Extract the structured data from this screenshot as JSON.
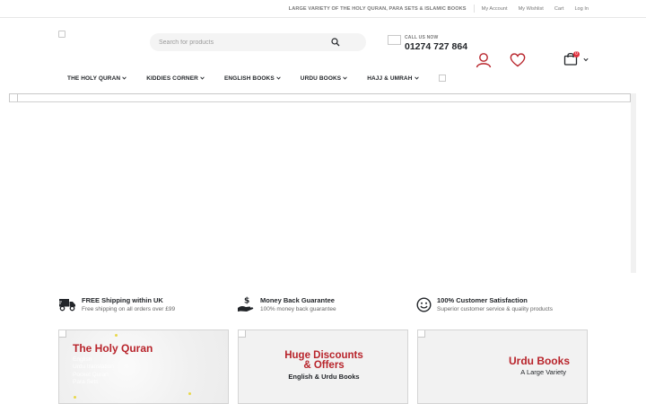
{
  "topbar": {
    "promo": "LARGE VARIETY OF THE HOLY QURAN, PARA SETS & ISLAMIC BOOKS",
    "links": [
      "My Account",
      "My Wishlist",
      "Cart",
      "Log In"
    ]
  },
  "header": {
    "search_placeholder": "Search for products",
    "call_label": "CALL US NOW",
    "phone": "01274 727 864",
    "cart_count": "0",
    "icons": [
      "search-icon",
      "user-icon",
      "heart-icon",
      "cart-icon"
    ]
  },
  "nav": {
    "items": [
      "THE HOLY QURAN",
      "KIDDIES CORNER",
      "ENGLISH BOOKS",
      "URDU BOOKS",
      "HAJJ & UMRAH"
    ]
  },
  "features": [
    {
      "title": "FREE Shipping within UK",
      "sub": "Free shipping on all orders over £99",
      "icon": "truck-icon"
    },
    {
      "title": "Money Back Guarantee",
      "sub": "100% money back guarantee",
      "icon": "money-hand-icon"
    },
    {
      "title": "100% Customer Satisfaction",
      "sub": "Superior customer service & quality products",
      "icon": "smiley-icon"
    }
  ],
  "cards": {
    "quran": {
      "heading": "The Holy Quran",
      "lines": [
        "English",
        "Urdu translation",
        "Pocket Quran",
        "Para Sets"
      ]
    },
    "discounts": {
      "heading_1": "Huge Discounts",
      "heading_2": "& Offers",
      "sub": "English & Urdu Books"
    },
    "urdu": {
      "heading": "Urdu Books",
      "sub": "A Large Variety"
    }
  },
  "colors": {
    "accent": "#b8242b",
    "badge": "#e23340",
    "text": "#222529"
  }
}
